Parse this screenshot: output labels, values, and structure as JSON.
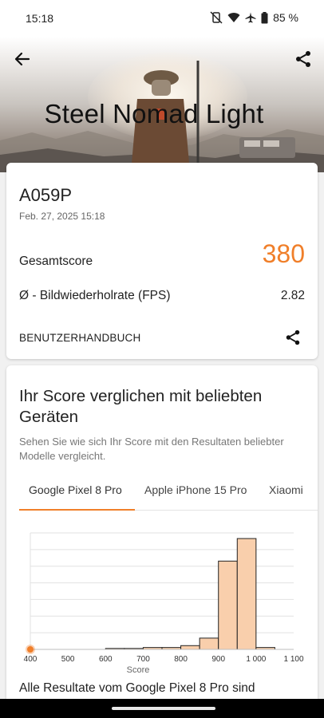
{
  "status": {
    "time": "15:18",
    "battery": "85 %"
  },
  "header": {
    "title": "Steel Nomad Light"
  },
  "result": {
    "device": "A059P",
    "date": "Feb. 27, 2025 15:18",
    "score_label": "Gesamtscore",
    "score_value": "380",
    "fps_label": "Ø - Bildwiederholrate (FPS)",
    "fps_value": "2.82",
    "manual_label": "BENUTZERHANDBUCH"
  },
  "comparison": {
    "title": "Ihr Score verglichen mit beliebten Geräten",
    "subtitle": "Sehen Sie wie sich Ihr Score mit den Resultaten beliebter Modelle vergleicht.",
    "tabs": [
      {
        "label": "Google Pixel 8 Pro",
        "active": true
      },
      {
        "label": "Apple iPhone 15 Pro",
        "active": false
      },
      {
        "label": "Xiaomi",
        "active": false
      }
    ],
    "footer": "Alle Resultate vom Google Pixel 8 Pro sind"
  },
  "colors": {
    "accent": "#f07f2a",
    "bar_fill": "#f9cfac",
    "marker": "#f07f2a"
  },
  "chart_data": {
    "type": "bar",
    "xlabel": "Score",
    "x_ticks": [
      "400",
      "500",
      "600",
      "700",
      "800",
      "900",
      "1 000",
      "1 100"
    ],
    "xlim": [
      400,
      1100
    ],
    "bins": [
      {
        "from": 600,
        "to": 650,
        "value": 0.5
      },
      {
        "from": 650,
        "to": 700,
        "value": 0.5
      },
      {
        "from": 700,
        "to": 750,
        "value": 1
      },
      {
        "from": 750,
        "to": 800,
        "value": 1
      },
      {
        "from": 800,
        "to": 850,
        "value": 2
      },
      {
        "from": 850,
        "to": 900,
        "value": 6
      },
      {
        "from": 900,
        "to": 950,
        "value": 47
      },
      {
        "from": 950,
        "to": 1000,
        "value": 59
      },
      {
        "from": 1000,
        "to": 1050,
        "value": 1
      }
    ],
    "ymax": 62,
    "grid_lines": 7,
    "marker_score": 380
  }
}
